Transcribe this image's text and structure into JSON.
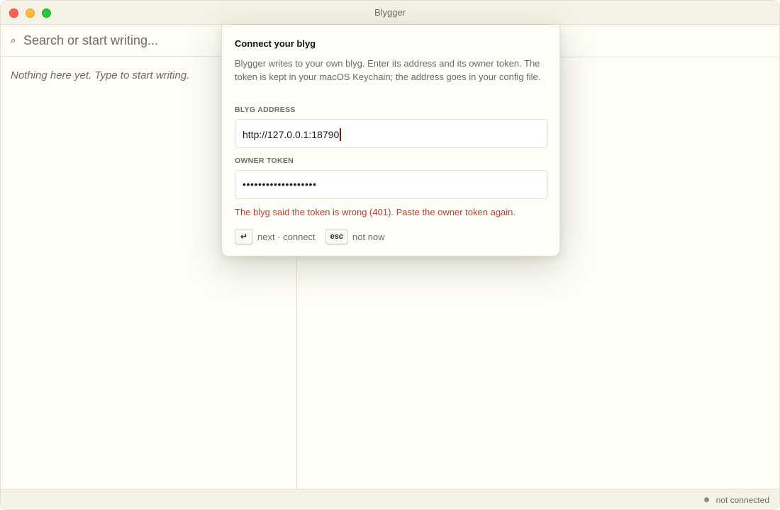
{
  "window": {
    "title": "Blygger"
  },
  "search": {
    "placeholder": "Search or start writing...",
    "icon": "search-icon"
  },
  "list": {
    "empty_text": "Nothing here yet. Type to start writing."
  },
  "modal": {
    "title": "Connect your blyg",
    "description": "Blygger writes to your own blyg. Enter its address and its owner token. The token is kept in your macOS Keychain; the address goes in your config file.",
    "address_label": "BLYG ADDRESS",
    "address_value": "http://127.0.0.1:18790",
    "token_label": "OWNER TOKEN",
    "token_masked": "•••••••••••••••••••",
    "error": "The blyg said the token is wrong (401). Paste the owner token again.",
    "hints": [
      {
        "key": "↵",
        "label": "next · connect"
      },
      {
        "key": "esc",
        "label": "not now"
      }
    ]
  },
  "status": {
    "text": "not connected"
  },
  "colors": {
    "background": "#fefef6",
    "chrome": "#f6f3e6",
    "error": "#c0392b",
    "close": "#fe5f57",
    "minimize": "#febc2e",
    "maximize": "#28c840"
  }
}
